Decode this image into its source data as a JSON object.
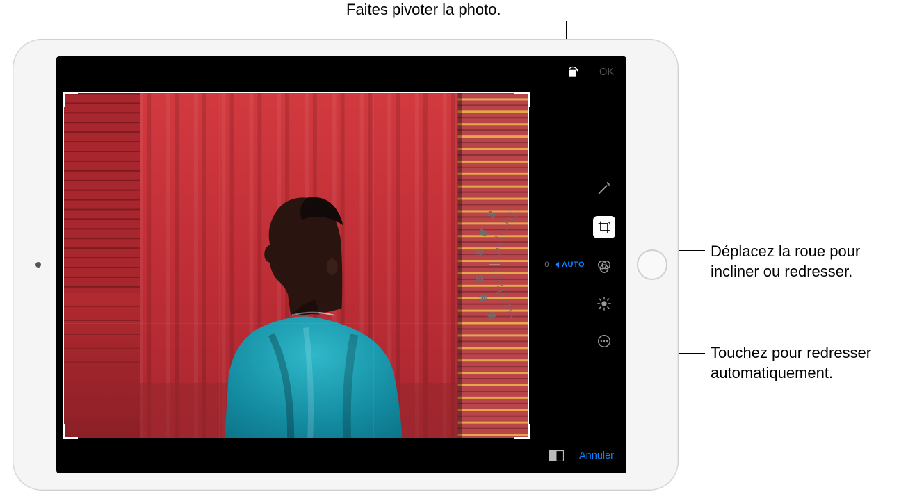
{
  "callouts": {
    "rotate": "Faites pivoter la photo.",
    "wheel": "Déplacez la roue pour\nincliner ou redresser.",
    "auto": "Touchez pour redresser\nautomatiquement."
  },
  "topbar": {
    "done_label": "OK"
  },
  "bottombar": {
    "cancel_label": "Annuler"
  },
  "dial": {
    "ticks": [
      "30",
      "20",
      "10",
      "0",
      "10",
      "20",
      "30"
    ],
    "center_value": "0",
    "auto_label": "AUTO"
  },
  "tools": {
    "wand": "auto-enhance",
    "crop": "crop-rotate",
    "filters": "filters",
    "adjust": "light-color",
    "more": "more"
  },
  "colors": {
    "accent": "#0a84ff"
  }
}
